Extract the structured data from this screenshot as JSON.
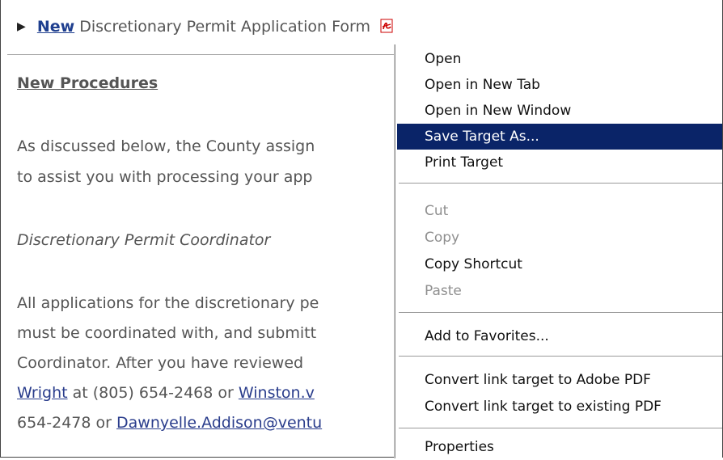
{
  "page": {
    "top_link": {
      "new_label": "New",
      "rest_label": " Discretionary Permit Application Form",
      "pdf_icon": "pdf-icon"
    },
    "heading": "New Procedures",
    "paragraph1": {
      "line1": "As discussed below, the County assign",
      "line2": "to assist you with processing your app"
    },
    "coordinator_title": "Discretionary Permit Coordinator",
    "paragraph2": {
      "line1": "All applications for the discretionary pe",
      "line2": "must be coordinated with, and submitt",
      "line3": "Coordinator.  After you have reviewed",
      "line4_link1": "Wright",
      "line4_text": " at (805) 654-2468 or ",
      "line4_link2": "Winston.v",
      "line5_text": "654-2478 or ",
      "line5_link": "Dawnyelle.Addison@ventu"
    }
  },
  "context_menu": {
    "groups": [
      [
        {
          "label": "Open",
          "state": "normal"
        },
        {
          "label": "Open in New Tab",
          "state": "normal"
        },
        {
          "label": "Open in New Window",
          "state": "normal"
        },
        {
          "label": "Save Target As...",
          "state": "highlighted"
        },
        {
          "label": "Print Target",
          "state": "normal"
        }
      ],
      [
        {
          "label": "Cut",
          "state": "disabled"
        },
        {
          "label": "Copy",
          "state": "disabled"
        },
        {
          "label": "Copy Shortcut",
          "state": "normal"
        },
        {
          "label": "Paste",
          "state": "disabled"
        }
      ],
      [
        {
          "label": "Add to Favorites...",
          "state": "normal"
        }
      ],
      [
        {
          "label": "Convert link target to Adobe PDF",
          "state": "normal"
        },
        {
          "label": "Convert link target to existing PDF",
          "state": "normal"
        }
      ],
      [
        {
          "label": "Properties",
          "state": "normal"
        }
      ]
    ]
  },
  "colors": {
    "highlight": "#0a2468",
    "link": "#2a3d8c",
    "disabled_text": "#8f8f8f"
  }
}
